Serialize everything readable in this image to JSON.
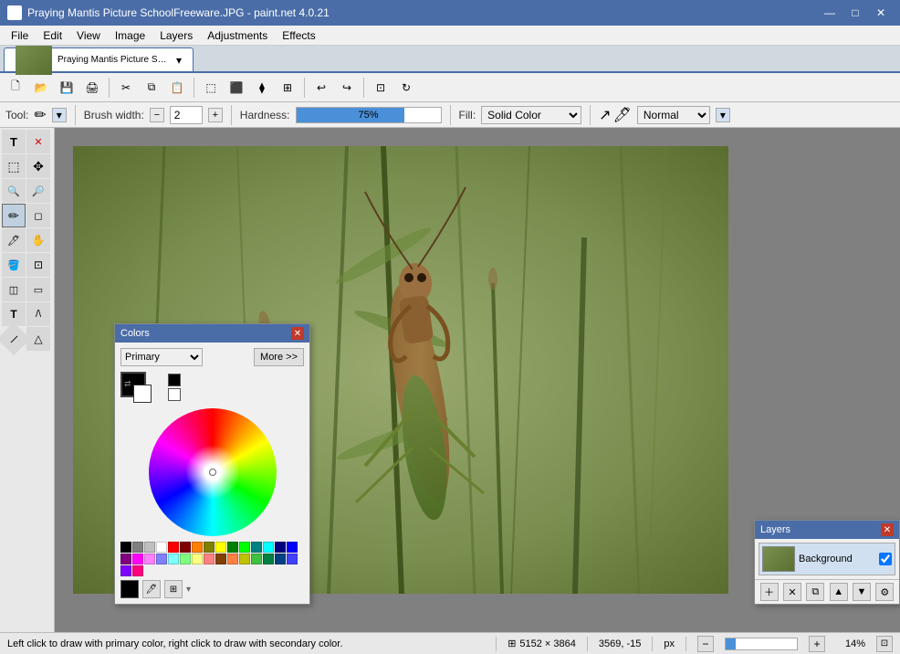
{
  "titlebar": {
    "title": "Praying Mantis Picture SchoolFreeware.JPG - paint.net 4.0.21",
    "min": "—",
    "max": "□",
    "close": "✕"
  },
  "menu": {
    "items": [
      "File",
      "Edit",
      "View",
      "Image",
      "Layers",
      "Adjustments",
      "Effects"
    ]
  },
  "options": {
    "tool_label": "Tool:",
    "brush_width_label": "Brush width:",
    "brush_width_value": "2",
    "hardness_label": "Hardness:",
    "hardness_value": "75%",
    "hardness_percent": 75,
    "fill_label": "Fill:",
    "fill_value": "Solid Color",
    "blend_value": "Normal"
  },
  "tools": [
    {
      "name": "text-tool",
      "icon": "T",
      "active": false
    },
    {
      "name": "close-tool",
      "icon": "✕",
      "active": false
    },
    {
      "name": "lasso-tool",
      "icon": "⬚",
      "active": false
    },
    {
      "name": "move-tool",
      "icon": "✥",
      "active": false
    },
    {
      "name": "zoom-in-tool",
      "icon": "🔍",
      "active": false
    },
    {
      "name": "zoom-out-tool",
      "icon": "🔍",
      "active": false
    },
    {
      "name": "pencil-tool",
      "icon": "✏",
      "active": true
    },
    {
      "name": "eraser-tool",
      "icon": "◻",
      "active": false
    },
    {
      "name": "color-picker-tool",
      "icon": "🖊",
      "active": false
    },
    {
      "name": "paint-bucket-tool",
      "icon": "🪣",
      "active": false
    },
    {
      "name": "gradient-tool",
      "icon": "◫",
      "active": false
    },
    {
      "name": "rectangle-tool",
      "icon": "⬜",
      "active": false
    },
    {
      "name": "text-insert-tool",
      "icon": "T",
      "active": false
    },
    {
      "name": "brush-tool",
      "icon": "A\\",
      "active": false
    },
    {
      "name": "line-tool",
      "icon": "╱",
      "active": false
    },
    {
      "name": "shape-tool",
      "icon": "△",
      "active": false
    }
  ],
  "tab": {
    "filename": "Praying Mantis Picture SchoolFreeware.JPG"
  },
  "colors_panel": {
    "title": "Colors",
    "close": "✕",
    "dropdown_value": "Primary",
    "more_label": "More >>",
    "palette": [
      "#000000",
      "#808080",
      "#c0c0c0",
      "#ffffff",
      "#ff0000",
      "#800000",
      "#ff8000",
      "#808000",
      "#ffff00",
      "#008000",
      "#00ff00",
      "#008080",
      "#00ffff",
      "#000080",
      "#0000ff",
      "#800080",
      "#ff00ff",
      "#ff80ff",
      "#8080ff",
      "#80ffff",
      "#80ff80",
      "#ffff80",
      "#ff8080",
      "#804000",
      "#ff8040",
      "#c0c000",
      "#40c040",
      "#008040",
      "#004080",
      "#4040ff",
      "#8000ff",
      "#ff0080"
    ]
  },
  "layers_panel": {
    "title": "Layers",
    "close": "✕",
    "layers": [
      {
        "name": "Background",
        "visible": true
      }
    ],
    "footer_btns": [
      "＋",
      "✕",
      "⧉",
      "▲",
      "▼",
      "⚙"
    ]
  },
  "statusbar": {
    "message": "Left click to draw with primary color, right click to draw with secondary color.",
    "dimensions": "5152 × 3864",
    "coords": "3569, -15",
    "unit": "px",
    "zoom": "14%"
  }
}
